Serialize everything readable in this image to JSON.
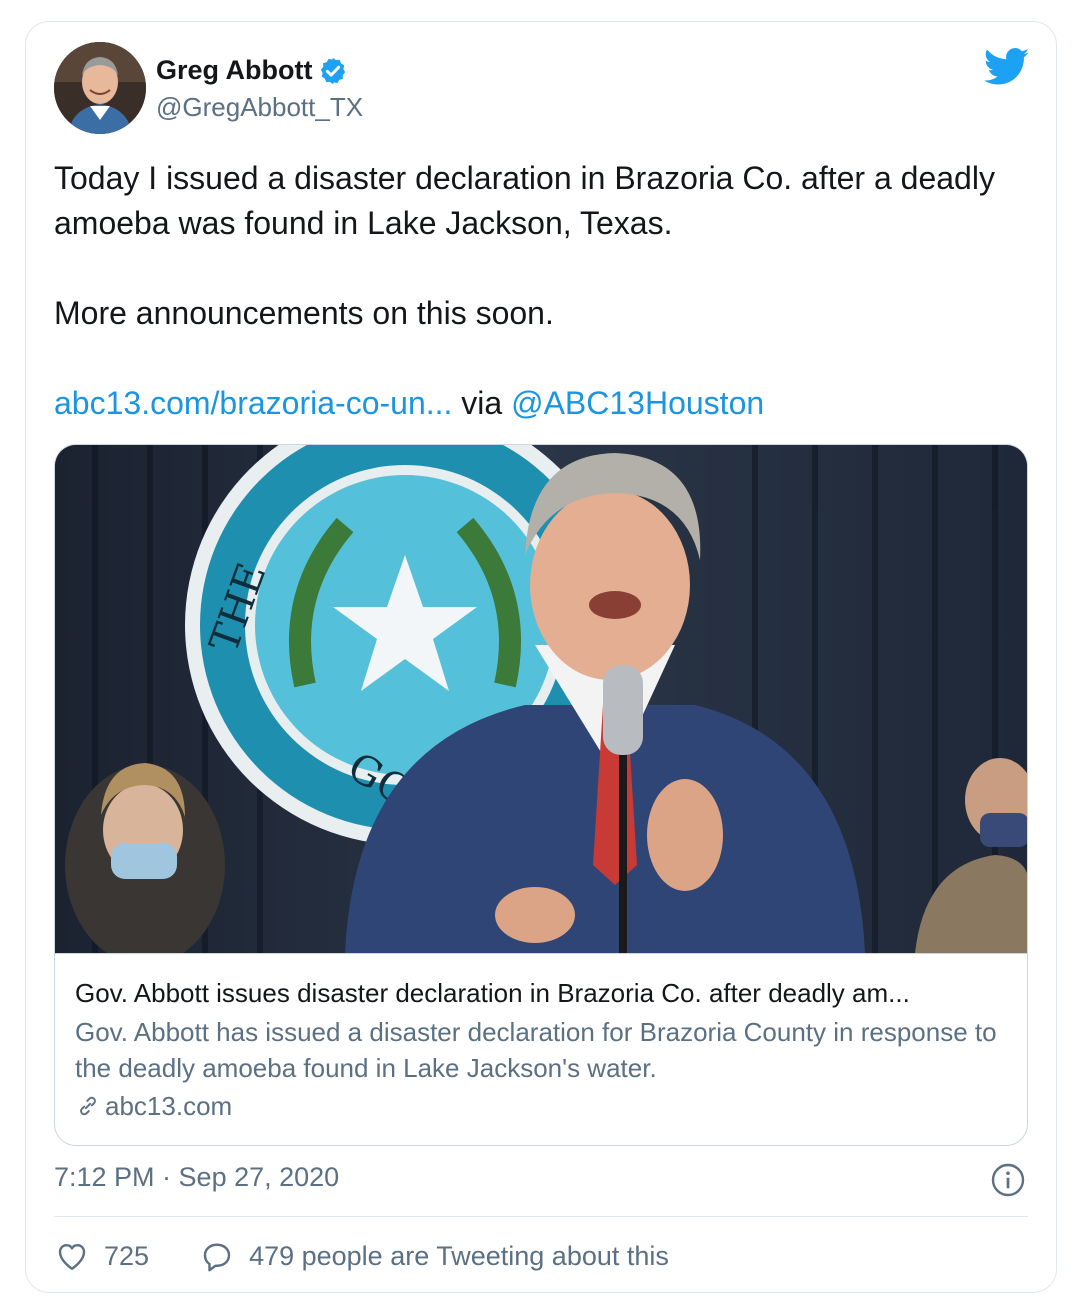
{
  "tweet": {
    "author_name": "Greg Abbott",
    "author_handle": "@GregAbbott_TX",
    "verified": true,
    "body_line1": "Today I issued a disaster declaration in Brazoria Co. after a deadly amoeba was found in Lake Jackson, Texas.",
    "body_line2": "More announcements on this soon.",
    "link_text": "abc13.com/brazoria-co-un...",
    "via_text": " via ",
    "mention": "@ABC13Houston",
    "timestamp": "7:12 PM · Sep 27, 2020"
  },
  "link_card": {
    "title": "Gov. Abbott issues disaster declaration in Brazoria Co. after deadly am...",
    "description": "Gov. Abbott has issued a disaster declaration for Brazoria County in response to the deadly amoeba found in Lake Jackson's water.",
    "domain": "abc13.com",
    "image_seal_text": "THE STATE OF TEXAS GOV"
  },
  "actions": {
    "like_count": "725",
    "reply_text": "479 people are Tweeting about this"
  },
  "icons": {
    "brand": "twitter-bird-icon",
    "verified": "verified-badge-icon",
    "link": "link-icon",
    "info": "info-icon",
    "like": "heart-icon",
    "reply": "reply-bubble-icon"
  },
  "colors": {
    "accent": "#1da1f2",
    "link": "#1b95e0",
    "secondary_text": "#5b7083",
    "border": "#e1e8ed"
  }
}
